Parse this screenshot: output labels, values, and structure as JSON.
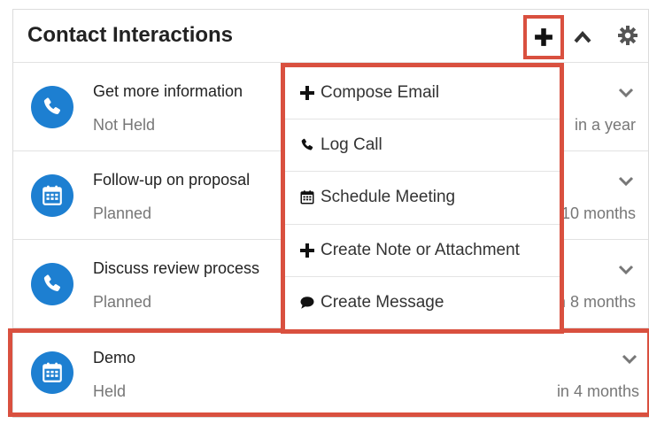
{
  "dashlet": {
    "title": "Contact Interactions"
  },
  "rows": [
    {
      "type": "call",
      "name": "Get more information",
      "status": "Not Held",
      "date": "in a year"
    },
    {
      "type": "meeting",
      "name": "Follow-up on proposal",
      "status": "Planned",
      "date": "in 10 months"
    },
    {
      "type": "call",
      "name": "Discuss review process",
      "status": "Planned",
      "date": "in 8 months"
    },
    {
      "type": "meeting",
      "name": "Demo",
      "status": "Held",
      "date": "in 4 months"
    }
  ],
  "menu": {
    "items": [
      {
        "icon": "plus-icon",
        "label": "Compose Email"
      },
      {
        "icon": "phone-icon",
        "label": "Log Call"
      },
      {
        "icon": "calendar-icon",
        "label": "Schedule Meeting"
      },
      {
        "icon": "plus-icon",
        "label": "Create Note or Attachment"
      },
      {
        "icon": "comment-icon",
        "label": "Create Message"
      }
    ]
  },
  "colors": {
    "accent": "#1d7fd1",
    "highlight": "#d9503f"
  }
}
